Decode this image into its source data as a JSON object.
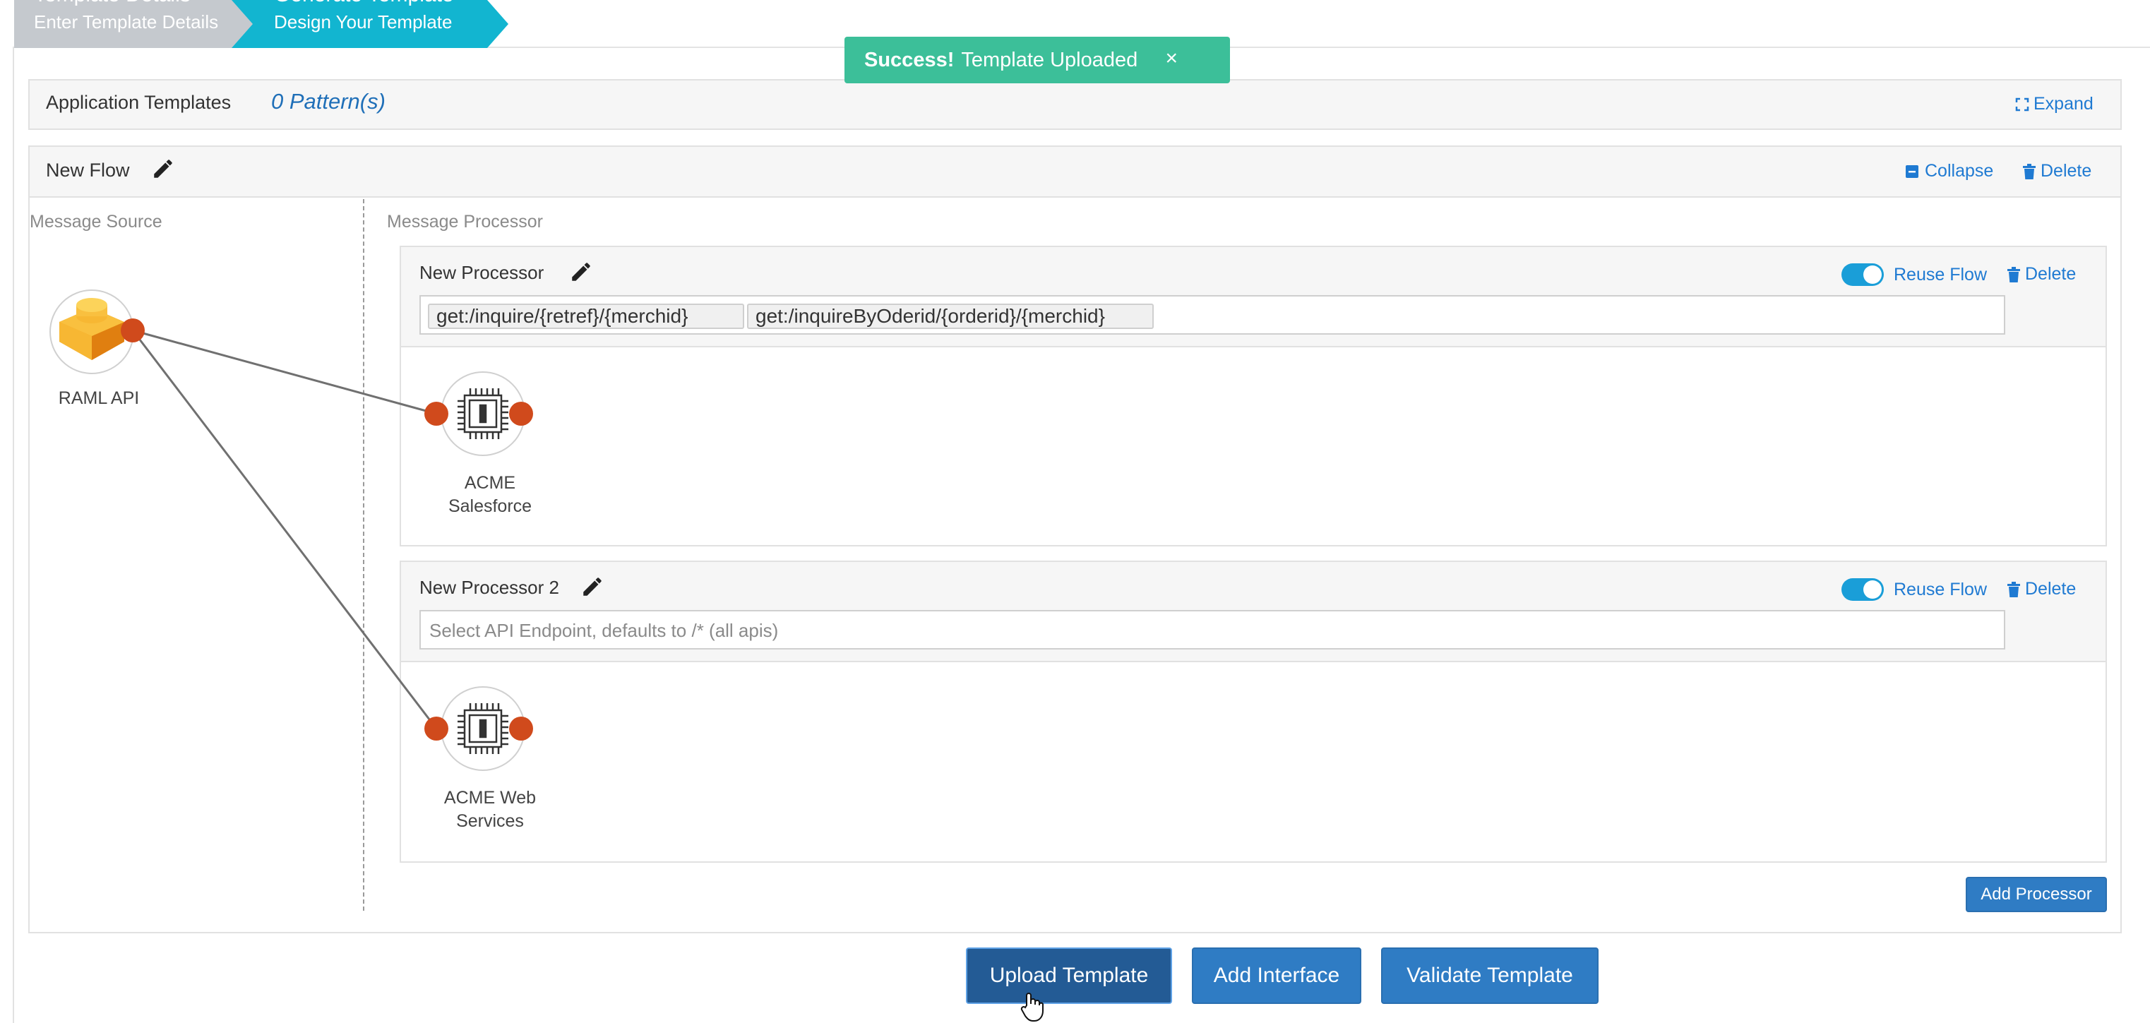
{
  "wizard": {
    "steps": [
      {
        "title": "Template Details",
        "subtitle": "Enter Template Details"
      },
      {
        "title": "Generate Template",
        "subtitle": "Design Your Template"
      }
    ]
  },
  "toast": {
    "strong": "Success!",
    "message": "Template Uploaded",
    "close": "×"
  },
  "app_templates": {
    "title": "Application Templates",
    "count": "0 Pattern(s)",
    "expand": "Expand"
  },
  "flow": {
    "title": "New Flow",
    "collapse": "Collapse",
    "delete": "Delete",
    "source_label": "Message Source",
    "processor_label": "Message Processor",
    "source_node": {
      "label": "RAML API",
      "icon": "raml-block-icon"
    },
    "processors": [
      {
        "title": "New Processor",
        "reuse_flow": "Reuse Flow",
        "reuse_enabled": true,
        "delete": "Delete",
        "endpoints": [
          "get:/inquire/{retref}/{merchid}",
          "get:/inquireByOderid/{orderid}/{merchid}"
        ],
        "placeholder": "",
        "node": {
          "label_line1": "ACME",
          "label_line2": "Salesforce",
          "icon": "cpu-chip-icon"
        }
      },
      {
        "title": "New Processor 2",
        "reuse_flow": "Reuse Flow",
        "reuse_enabled": true,
        "delete": "Delete",
        "endpoints": [],
        "placeholder": "Select API Endpoint, defaults to /* (all apis)",
        "node": {
          "label_line1": "ACME Web",
          "label_line2": "Services",
          "icon": "cpu-chip-icon"
        }
      }
    ],
    "add_processor": "Add Processor"
  },
  "actions": {
    "upload": "Upload Template",
    "add_interface": "Add Interface",
    "validate": "Validate Template"
  },
  "colors": {
    "accent": "#2f7cc4",
    "success": "#3cbf99",
    "port": "#d04a1c",
    "wizard_active": "#12b5d0"
  }
}
